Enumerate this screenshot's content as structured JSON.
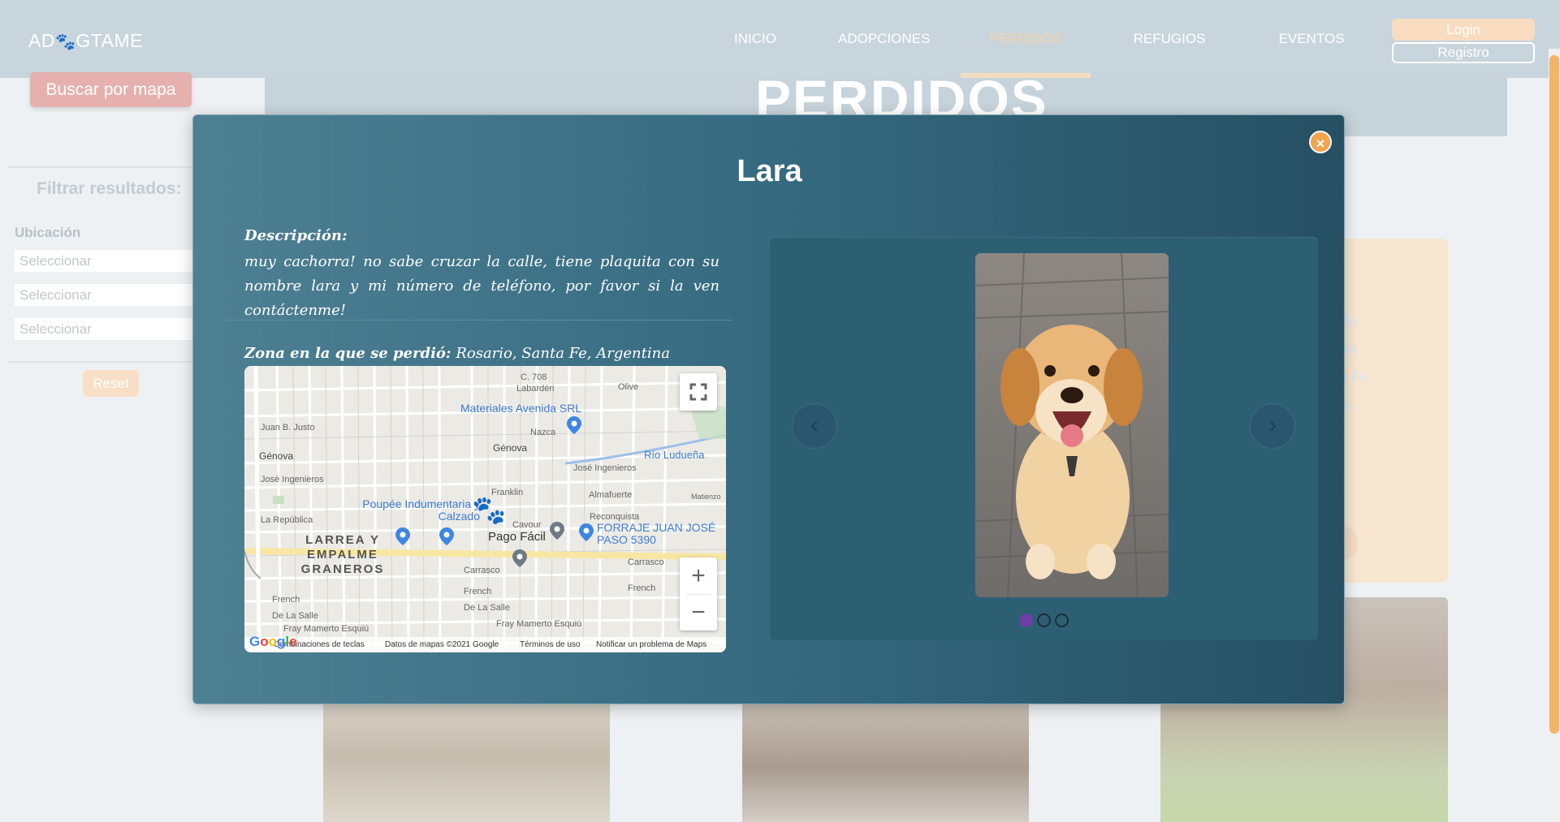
{
  "brand": {
    "logo_prefix": "AD",
    "logo_suffix": "GTAME"
  },
  "nav": {
    "links": [
      "INICIO",
      "ADOPCIONES",
      "PERDIDOS",
      "REFUGIOS",
      "EVENTOS"
    ],
    "active": "PERDIDOS",
    "login": "Login",
    "registro": "Registro"
  },
  "page": {
    "hero_title": "PERDIDOS"
  },
  "sidebar": {
    "map_button": "Buscar por mapa",
    "filter_title": "Filtrar resultados:",
    "location_label": "Ubicación",
    "selects": [
      "Seleccionar",
      "Seleccionar",
      "Seleccionar"
    ],
    "reset": "Reset"
  },
  "bg_card": {
    "fragments": [
      "ño",
      "na",
      "a Fe",
      "ío"
    ]
  },
  "modal": {
    "name": "Lara",
    "description_label": "Descripción:",
    "description": "muy cachorra! no sabe cruzar la calle, tiene plaquita con su nombre lara y mi número de teléfono, por favor si la ven contáctenme!",
    "zone_label": "Zona en la que se perdió:",
    "zone_value": "Rosario, Santa Fe, Argentina",
    "close_symbol": "×"
  },
  "map": {
    "places": {
      "materiales": "Materiales Avenida SRL",
      "poupee": "Poupée Indumentaria y Calzado",
      "pago_facil": "Pago Fácil",
      "forraje": "FORRAJE JUAN JOSÉ PASO 5390",
      "larrea": "LARREA Y EMPALME GRANEROS",
      "rio": "Río Ludueña"
    },
    "streets": {
      "genova1": "Génova",
      "genova2": "Génova",
      "jose_ing": "José Ingenieros",
      "jose_ing2": "José Ingenieros",
      "republica": "La República",
      "nazca": "Nazca",
      "juan_b": "Juan B. Justo",
      "labarden": "Labardén",
      "olive": "Olive",
      "franklin": "Franklin",
      "almafuerte": "Almafuerte",
      "reconquista": "Reconquista",
      "cavour": "Cavour",
      "carrasco": "Carrasco",
      "carrasco2": "Carrasco",
      "french": "French",
      "french2": "French",
      "delasalle": "De La Salle",
      "delasalle2": "De La Salle",
      "fray": "Fray Mamerto Esquiú",
      "fray2": "Fray Mamerto Esquiú",
      "matienzo": "Matienzo"
    },
    "footer": [
      "Combinaciones de teclas",
      "Datos de mapas ©2021 Google",
      "Términos de uso",
      "Notificar un problema de Maps"
    ],
    "zoom_in": "+",
    "zoom_out": "−",
    "logo": "Google"
  },
  "carousel": {
    "prev": "‹",
    "next": "›",
    "slides": 3,
    "active_slide": 1
  }
}
